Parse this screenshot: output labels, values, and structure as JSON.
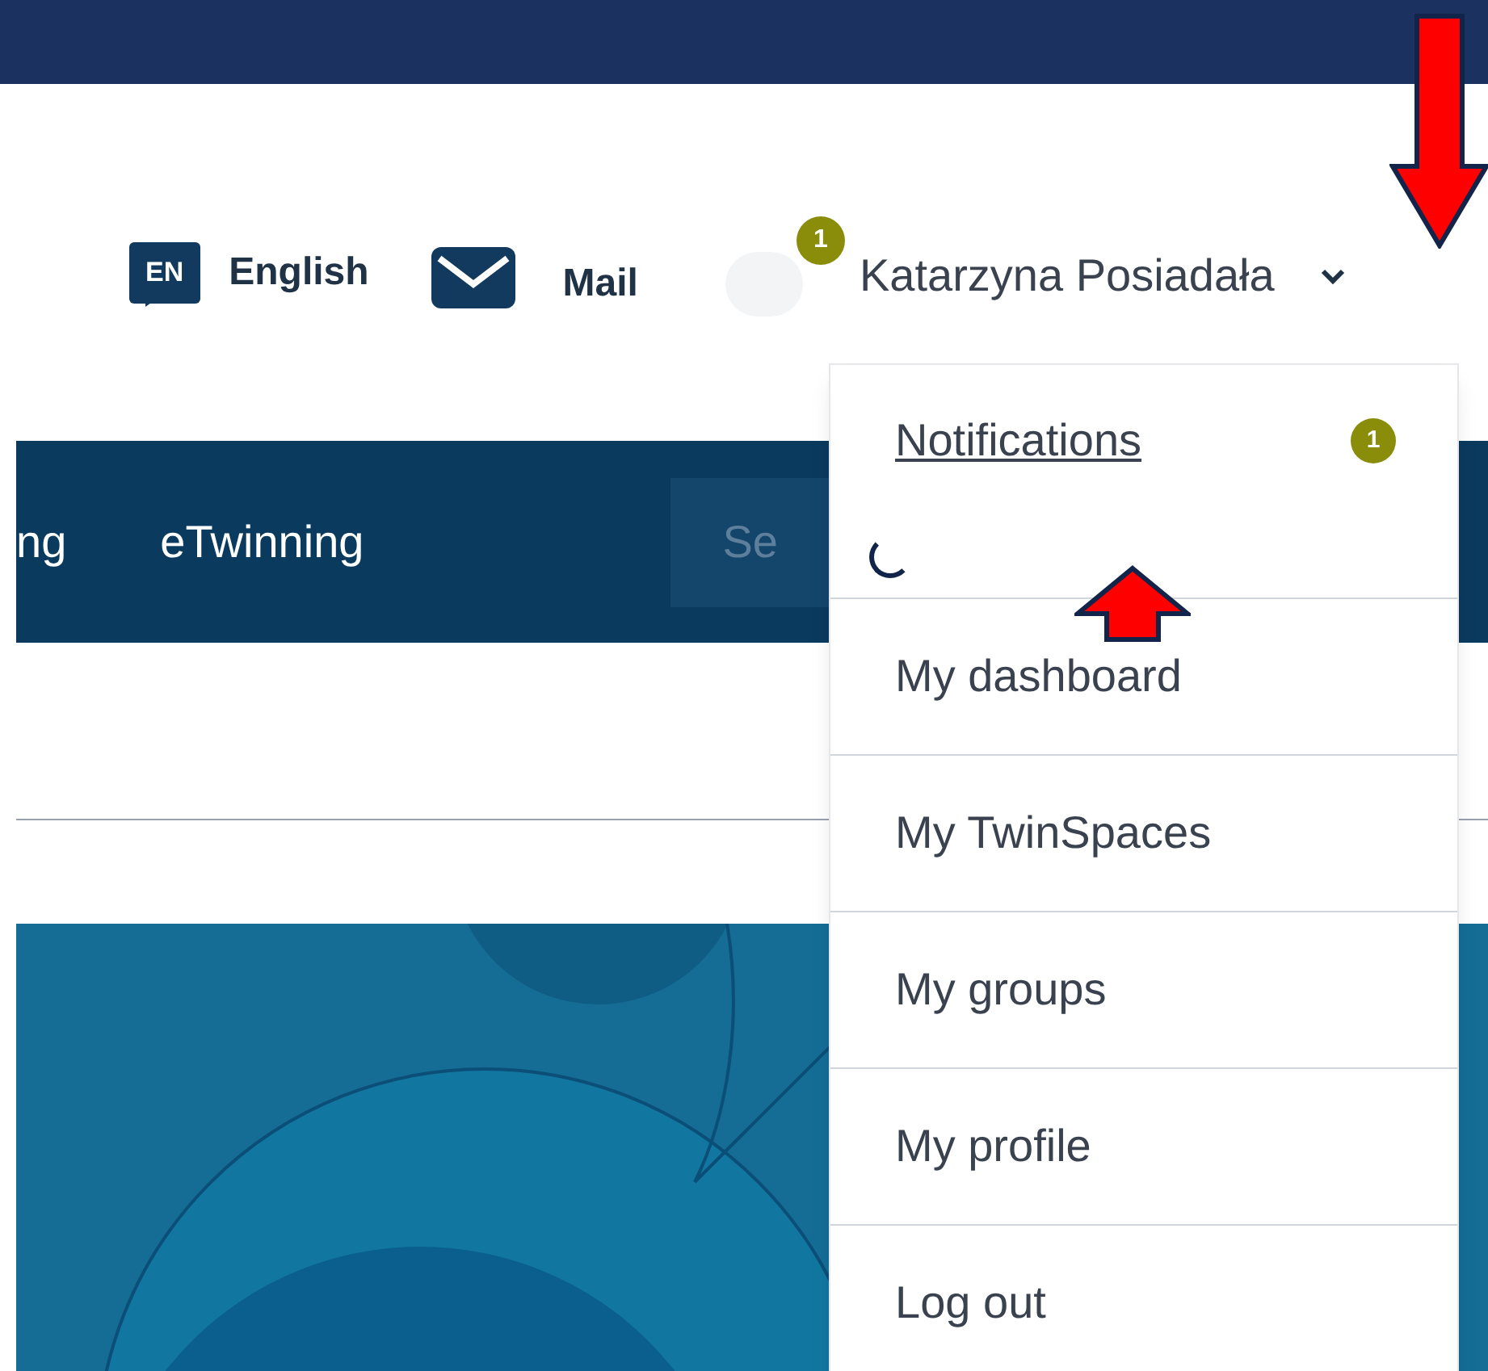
{
  "header": {
    "language": {
      "code": "EN",
      "label": "English"
    },
    "mail": {
      "label": "Mail"
    },
    "user": {
      "name": "Katarzyna Posiadała",
      "notification_count": "1"
    }
  },
  "nav": {
    "items": [
      {
        "label": "ng"
      },
      {
        "label": "eTwinning"
      }
    ],
    "search": {
      "placeholder": "Se"
    }
  },
  "user_menu": {
    "items": [
      {
        "label": "Notifications",
        "badge": "1",
        "hovered": true
      },
      {
        "label": "My dashboard",
        "hovered": false
      },
      {
        "label": "My TwinSpaces",
        "hovered": false
      },
      {
        "label": "My groups",
        "hovered": false
      },
      {
        "label": "My profile",
        "hovered": false
      },
      {
        "label": "Log out",
        "hovered": false
      }
    ]
  }
}
